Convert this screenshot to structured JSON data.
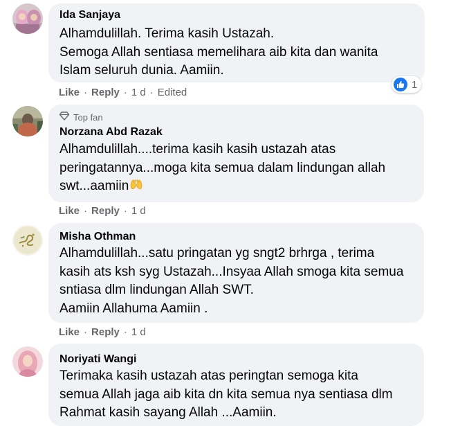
{
  "comments": [
    {
      "author": "Ida Sanjaya",
      "text": "Alhamdulillah. Terima kasih Ustazah.\nSemoga Allah sentiasa memelihara aib kita dan wanita\nIslam seluruh dunia. Aamiin.",
      "like_label": "Like",
      "reply_label": "Reply",
      "time": "1 d",
      "edited_label": "Edited",
      "reaction_count": "1",
      "reaction_icon": "like-icon"
    },
    {
      "badge": "Top fan",
      "badge_icon": "diamond-icon",
      "author": "Norzana Abd Razak",
      "text": "Alhamdulillah....terima kasih kasih ustazah atas\nperingatannya...moga kita semua dalam lindungan allah\nswt...aamiin",
      "emoji": "raising-hands-emoji",
      "like_label": "Like",
      "reply_label": "Reply",
      "time": "1 d"
    },
    {
      "author": "Misha Othman",
      "text": "Alhamdulillah...satu pringatan yg sngt2 brhrga , terima\nkasih ats ksh syg Ustazah...Insyaa Allah smoga kita semua\nsntiasa dlm lindungan Allah SWT.\nAamiin Allahuma Aamiin .",
      "like_label": "Like",
      "reply_label": "Reply",
      "time": "1 d"
    },
    {
      "author": "Noriyati Wangi",
      "text": "Terimaka kasih ustazah atas peringtan semoga kita\nsemua Allah jaga aib kita dn kita semua nya sentiasa dlm\nRahmat kasih sayang Allah ...Aamiin."
    }
  ],
  "colors": {
    "bubble": "#f0f2f5",
    "secondary_text": "#65676b",
    "like_blue": "#1877f2"
  }
}
